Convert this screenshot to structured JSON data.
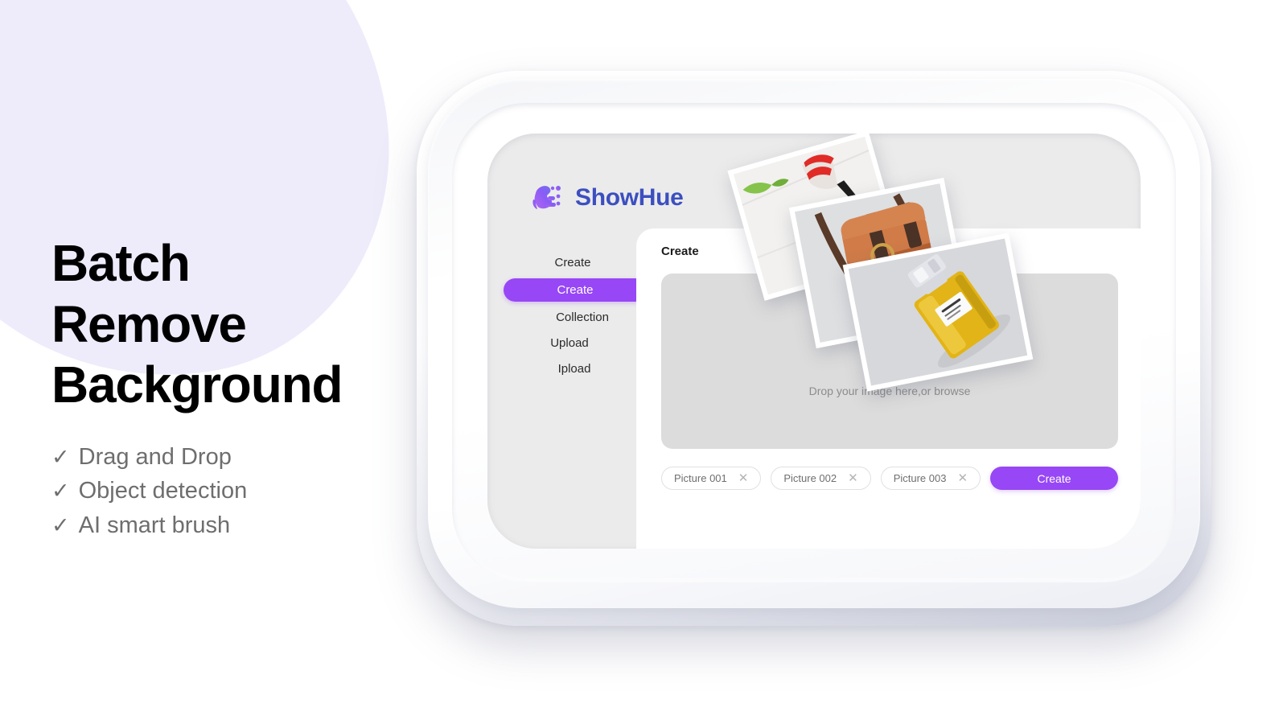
{
  "marketing": {
    "headline": "Batch\nRemove\nBackground",
    "features": [
      {
        "check": "✓",
        "label": "Drag and Drop"
      },
      {
        "check": "✓",
        "label": "Object detection"
      },
      {
        "check": "✓",
        "label": "AI smart brush"
      }
    ]
  },
  "app": {
    "brand": {
      "name": "ShowHue",
      "mark_icon": "showhue-logo-icon"
    },
    "sidebar": {
      "items": [
        {
          "label": "Create",
          "active": false
        },
        {
          "label": "Create",
          "active": true
        },
        {
          "label": "Collection",
          "active": false
        },
        {
          "label": "Upload",
          "active": false
        },
        {
          "label": "Ipload",
          "active": false
        }
      ]
    },
    "panel": {
      "title": "Create",
      "dropzone": {
        "icon": "upload-tray-icon",
        "text": "Drop your image here,or browse"
      },
      "chips": [
        {
          "label": "Picture  001",
          "close_icon": "✕"
        },
        {
          "label": "Picture  002",
          "close_icon": "✕"
        },
        {
          "label": "Picture  003",
          "close_icon": "✕"
        }
      ],
      "create_button": "Create"
    },
    "photos": [
      {
        "name": "red-heels-photo",
        "alt": "Red high heel shoes on white marble"
      },
      {
        "name": "leather-bag-photo",
        "alt": "Tan leather satchel bag"
      },
      {
        "name": "perfume-bottle-photo",
        "alt": "Yellow perfume bottle"
      }
    ]
  },
  "colors": {
    "accent_purple": "#9747f5",
    "brand_blue": "#3c4fc0",
    "blob_lavender": "#eeecfb",
    "screen_bg": "#ebebeb",
    "dropzone_bg": "#dcdcdc",
    "muted_text": "#6e6e6e"
  }
}
